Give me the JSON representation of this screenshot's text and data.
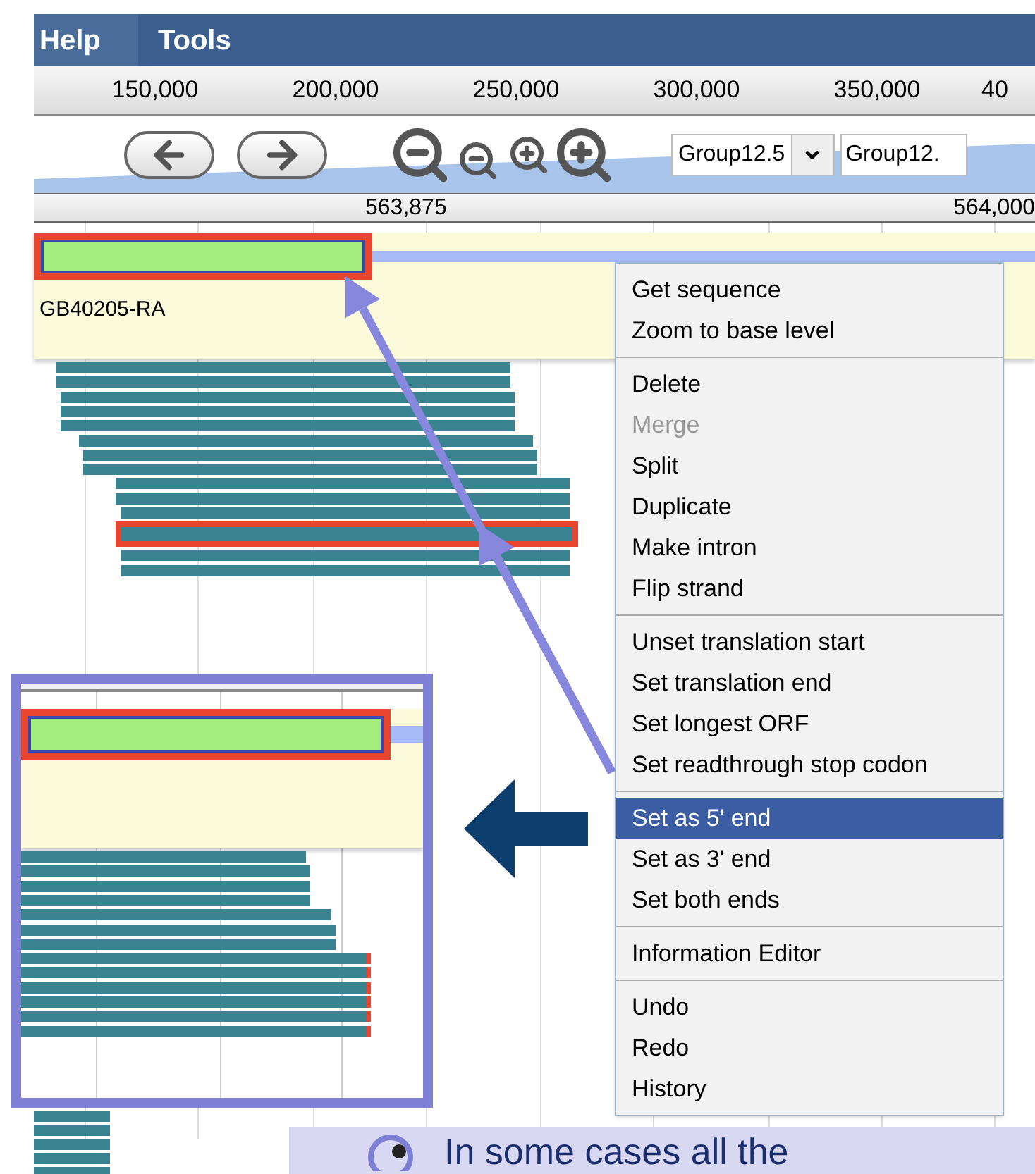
{
  "menu_bar": [
    {
      "label": "Help",
      "selected": true
    },
    {
      "label": "Tools",
      "selected": false
    }
  ],
  "overview_ruler": [
    "150,000",
    "200,000",
    "250,000",
    "300,000",
    "350,000",
    "40"
  ],
  "navigation": {
    "sequence_select": "Group12.5",
    "location_field": "Group12."
  },
  "position_ruler": [
    "563,875",
    "564,000"
  ],
  "annotation_track": {
    "feature_label": "GB40205-RA",
    "selected": true
  },
  "evidence_track": {
    "rows": [
      {
        "selected": false
      },
      {
        "selected": false
      },
      {
        "selected": false
      },
      {
        "selected": false
      },
      {
        "selected": false
      },
      {
        "selected": false
      },
      {
        "selected": false
      },
      {
        "selected": false
      },
      {
        "selected": false
      },
      {
        "selected": false
      },
      {
        "selected": false
      },
      {
        "selected": true
      },
      {
        "selected": false
      },
      {
        "selected": false
      }
    ]
  },
  "context_menu": {
    "groups": [
      {
        "items": [
          {
            "label": "Get sequence",
            "disabled": false,
            "selected": false
          },
          {
            "label": "Zoom to base level",
            "disabled": false,
            "selected": false
          }
        ]
      },
      {
        "items": [
          {
            "label": "Delete",
            "disabled": false,
            "selected": false
          },
          {
            "label": "Merge",
            "disabled": true,
            "selected": false
          },
          {
            "label": "Split",
            "disabled": false,
            "selected": false
          },
          {
            "label": "Duplicate",
            "disabled": false,
            "selected": false
          },
          {
            "label": "Make intron",
            "disabled": false,
            "selected": false
          },
          {
            "label": "Flip strand",
            "disabled": false,
            "selected": false
          }
        ]
      },
      {
        "items": [
          {
            "label": "Unset translation start",
            "disabled": false,
            "selected": false
          },
          {
            "label": "Set translation end",
            "disabled": false,
            "selected": false
          },
          {
            "label": "Set longest ORF",
            "disabled": false,
            "selected": false
          },
          {
            "label": "Set readthrough stop codon",
            "disabled": false,
            "selected": false
          }
        ]
      },
      {
        "items": [
          {
            "label": "Set as 5' end",
            "disabled": false,
            "selected": true
          },
          {
            "label": "Set as 3' end",
            "disabled": false,
            "selected": false
          },
          {
            "label": "Set both ends",
            "disabled": false,
            "selected": false
          }
        ]
      },
      {
        "items": [
          {
            "label": "Information Editor",
            "disabled": false,
            "selected": false
          }
        ]
      },
      {
        "items": [
          {
            "label": "Undo",
            "disabled": false,
            "selected": false
          },
          {
            "label": "Redo",
            "disabled": false,
            "selected": false
          },
          {
            "label": "History",
            "disabled": false,
            "selected": false
          }
        ]
      }
    ]
  },
  "caption": "In some cases all the"
}
